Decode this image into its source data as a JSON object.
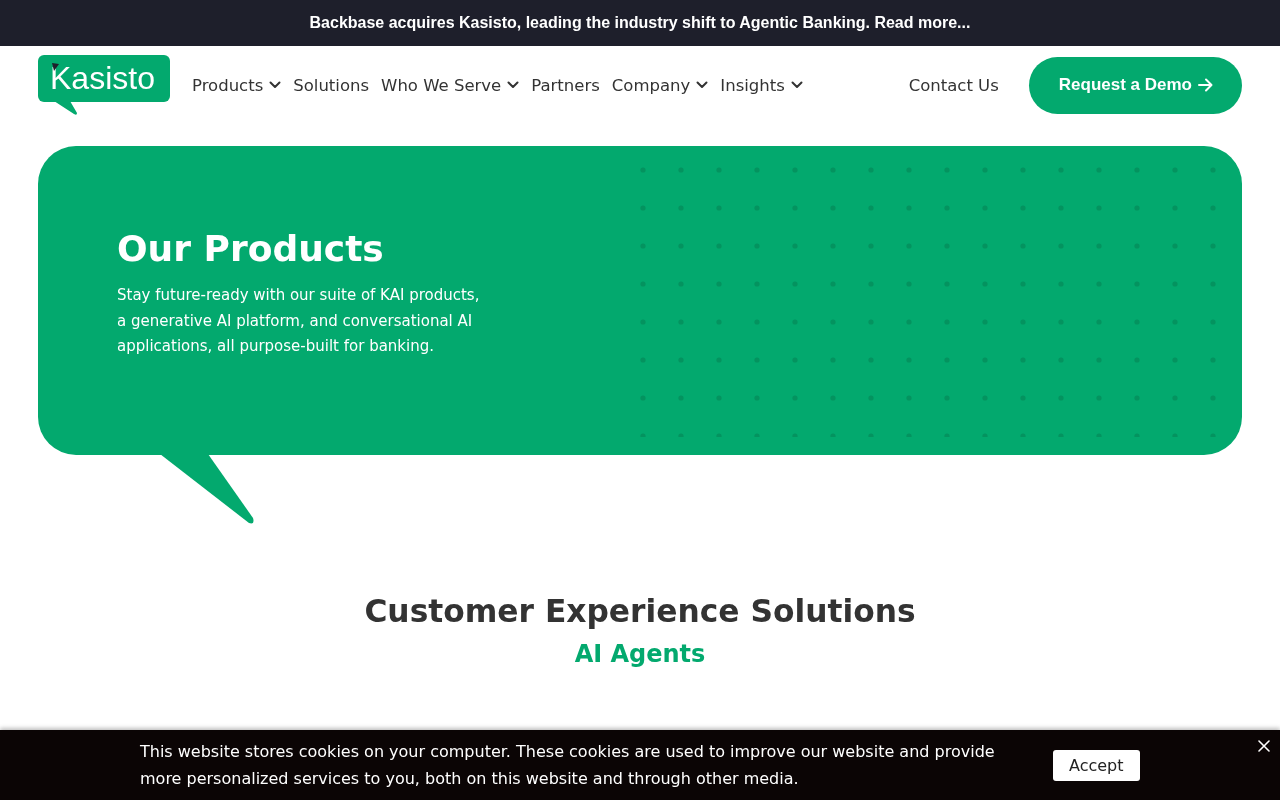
{
  "announcement": {
    "text": "Backbase acquires Kasisto, leading the industry shift to Agentic Banking. Read more..."
  },
  "header": {
    "logo": "Kasisto",
    "nav": [
      {
        "label": "Products",
        "dropdown": true
      },
      {
        "label": "Solutions",
        "dropdown": false
      },
      {
        "label": "Who We Serve",
        "dropdown": true
      },
      {
        "label": "Partners",
        "dropdown": false
      },
      {
        "label": "Company",
        "dropdown": true
      },
      {
        "label": "Insights",
        "dropdown": true
      }
    ],
    "contact_link": "Contact Us",
    "cta_button": "Request a Demo"
  },
  "hero": {
    "title": "Our Products",
    "description": "Stay future-ready with our suite of KAI products, a generative AI platform, and conversational AI applications, all purpose-built for banking."
  },
  "section": {
    "title": "Customer Experience Solutions",
    "subtitle": "AI Agents"
  },
  "cookie_banner": {
    "text": "This website stores cookies on your computer. These cookies are used to improve our website and provide more personalized services to you, both on this website and through other media.",
    "accept_button": "Accept"
  }
}
